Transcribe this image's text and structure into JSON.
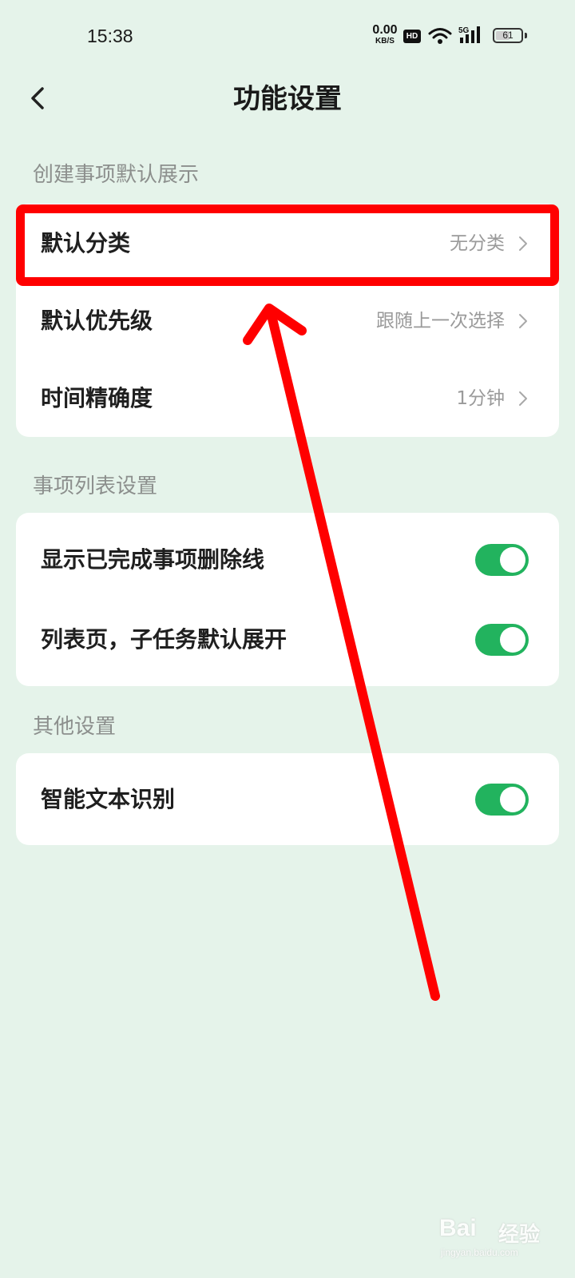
{
  "status_bar": {
    "time": "15:38",
    "net_speed_value": "0.00",
    "net_speed_unit": "KB/S",
    "hd_label": "HD",
    "signal_label": "5G",
    "battery_level": "61",
    "icons": [
      "wifi-icon",
      "signal-icon",
      "battery-icon"
    ]
  },
  "header": {
    "back_icon": "chevron-left-icon",
    "title": "功能设置"
  },
  "sections": [
    {
      "title": "创建事项默认展示",
      "rows": [
        {
          "label": "默认分类",
          "value": "无分类"
        },
        {
          "label": "默认优先级",
          "value": "跟随上一次选择"
        },
        {
          "label": "时间精确度",
          "value": "1分钟"
        }
      ]
    },
    {
      "title": "事项列表设置",
      "rows": [
        {
          "label": "显示已完成事项删除线",
          "toggle_on": true
        },
        {
          "label": "列表页，子任务默认展开",
          "toggle_on": true
        }
      ]
    },
    {
      "title": "其他设置",
      "rows": [
        {
          "label": "智能文本识别",
          "toggle_on": true
        }
      ]
    }
  ],
  "colors": {
    "background": "#e5f3ea",
    "card": "#ffffff",
    "toggle_on": "#22b35e",
    "annotation": "#ff0000",
    "section_title": "#8c8f8d",
    "value_text": "#9a9a9a"
  },
  "watermark": {
    "brand": "Bai",
    "suffix": "经验",
    "url": "jingyan.baidu.com"
  }
}
